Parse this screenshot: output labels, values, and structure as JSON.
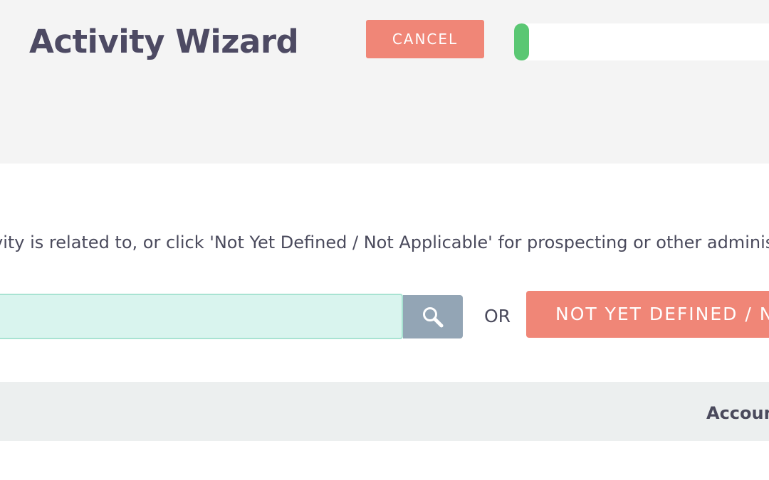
{
  "header": {
    "title": "Activity Wizard",
    "cancel_label": "CANCEL",
    "progress": 0.06
  },
  "main": {
    "instructions": "vity is related to, or click 'Not Yet Defined / Not Applicable' for prospecting or other administrat",
    "search": {
      "value": "",
      "placeholder": ""
    },
    "search_icon": "search-icon",
    "or_label": "OR",
    "not_yet_defined_label": "NOT YET DEFINED / N"
  },
  "table": {
    "columns": [
      "Accoun"
    ]
  },
  "colors": {
    "accent_salmon": "#f08677",
    "progress_green": "#5ac773",
    "search_bg": "#d9f4ee",
    "search_button": "#93a5b5"
  }
}
